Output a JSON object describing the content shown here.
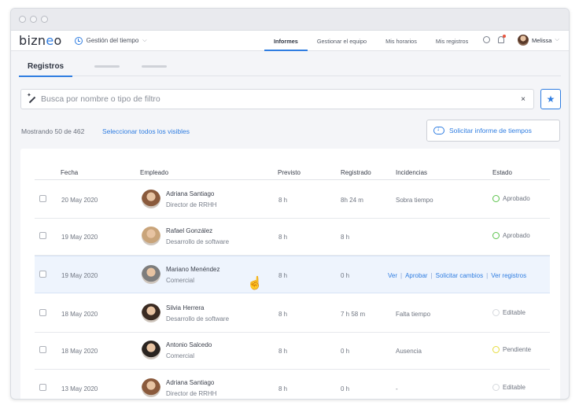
{
  "browser": {
    "dots": 3
  },
  "topnav": {
    "logo_prefix": "bizn",
    "logo_accent": "e",
    "logo_suffix": "o",
    "module": "Gestión del tiempo",
    "links": [
      {
        "label": "Informes",
        "active": true
      },
      {
        "label": "Gestionar el equipo",
        "active": false
      },
      {
        "label": "Mis horarios",
        "active": false
      },
      {
        "label": "Mis registros",
        "active": false
      }
    ],
    "user_name": "Melissa"
  },
  "tabs": {
    "active": "Registros"
  },
  "search": {
    "placeholder": "Busca por nombre o tipo de filtro",
    "clear": "×",
    "favorite": "★"
  },
  "summary": {
    "showing": "Mostrando 50 de 462",
    "select_all": "Seleccionar todos los visibles",
    "report_button": "Solicitar informe de tiempos"
  },
  "table": {
    "headers": [
      "Fecha",
      "Empleado",
      "Previsto",
      "Registrado",
      "Incidencias",
      "Estado"
    ],
    "actions": [
      "Ver",
      "Aprobar",
      "Solicitar cambios",
      "Ver registros"
    ],
    "rows": [
      {
        "date": "20 May 2020",
        "name": "Adriana Santiago",
        "role": "Director de RRHH",
        "planned": "8 h",
        "registered": "8h 24 m",
        "incident": "Sobra tiempo",
        "status": "Aprobado",
        "status_color": "#5cc34d",
        "highlight": false,
        "avatar": "#8a5a3c"
      },
      {
        "date": "19 May 2020",
        "name": "Rafael González",
        "role": "Desarrollo de software",
        "planned": "8 h",
        "registered": "8 h",
        "incident": "",
        "status": "Aprobado",
        "status_color": "#5cc34d",
        "highlight": false,
        "avatar": "#c9a47a"
      },
      {
        "date": "19 May 2020",
        "name": "Mariano Menéndez",
        "role": "Comercial",
        "planned": "8 h",
        "registered": "0 h",
        "incident": "",
        "status": "",
        "status_color": "",
        "highlight": true,
        "avatar": "#7d7d7d"
      },
      {
        "date": "18 May 2020",
        "name": "Silvia Herrera",
        "role": "Desarrollo de software",
        "planned": "8 h",
        "registered": "7 h 58 m",
        "incident": "Falta tiempo",
        "status": "Editable",
        "status_color": "#d5d8dd",
        "highlight": false,
        "avatar": "#3a2b22"
      },
      {
        "date": "18 May 2020",
        "name": "Antonio Salcedo",
        "role": "Comercial",
        "planned": "8 h",
        "registered": "0 h",
        "incident": "Ausencia",
        "status": "Pendiente",
        "status_color": "#e6dc3c",
        "highlight": false,
        "avatar": "#2a2420"
      },
      {
        "date": "13 May 2020",
        "name": "Adriana Santiago",
        "role": "Director de RRHH",
        "planned": "8 h",
        "registered": "0 h",
        "incident": "-",
        "status": "Editable",
        "status_color": "#d5d8dd",
        "highlight": false,
        "avatar": "#8a5a3c"
      }
    ]
  }
}
